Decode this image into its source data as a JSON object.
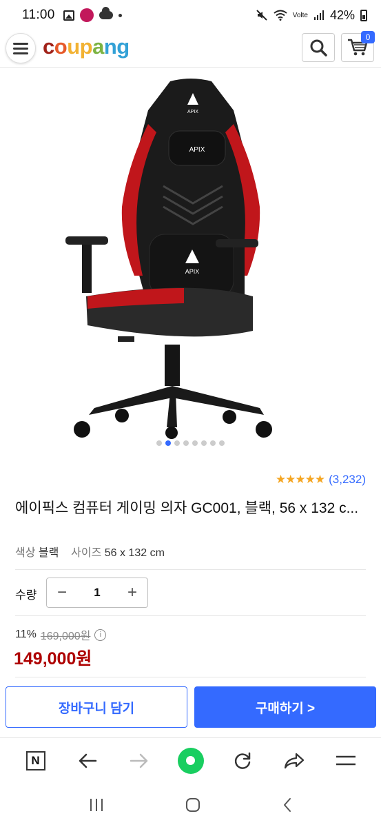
{
  "status_bar": {
    "time": "11:00",
    "battery": "42%",
    "network": "Volte"
  },
  "header": {
    "logo": [
      "c",
      "o",
      "u",
      "p",
      "a",
      "n",
      "g"
    ],
    "cart_count": "0"
  },
  "gallery": {
    "total": 8,
    "active": 1
  },
  "product": {
    "rating_stars": "★★★★★",
    "review_count": "(3,232)",
    "title": "에이픽스 컴퓨터 게이밍 의자 GC001, 블랙, 56 x 132 c...",
    "color_label": "색상",
    "color_value": "블랙",
    "size_label": "사이즈",
    "size_value": "56 x 132 cm"
  },
  "quantity": {
    "label": "수량",
    "value": "1",
    "minus": "−",
    "plus": "+"
  },
  "pricing": {
    "discount": "11%",
    "original": "169,000원",
    "price": "149,000원"
  },
  "actions": {
    "add_to_cart": "장바구니 담기",
    "buy_now": "구매하기 >"
  },
  "browser_nav": {
    "n_label": "N"
  },
  "colors": {
    "accent": "#346aff",
    "price": "#ae0000",
    "star": "#f5a623",
    "home": "#19ce60"
  }
}
